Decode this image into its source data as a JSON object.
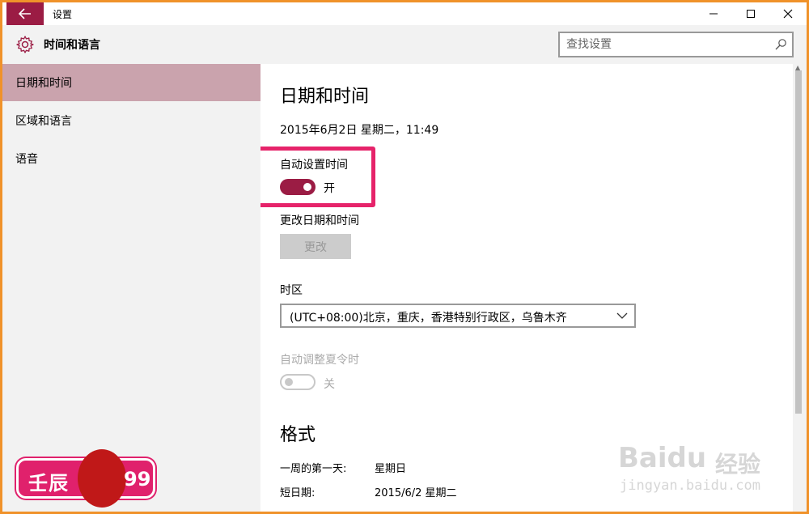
{
  "window": {
    "title": "设置",
    "back_icon": "arrow-left-icon",
    "controls": [
      "minimize-icon",
      "maximize-icon",
      "close-icon"
    ]
  },
  "header": {
    "title": "时间和语言",
    "icon": "gear-icon",
    "search_placeholder": "查找设置"
  },
  "sidebar": {
    "items": [
      {
        "label": "日期和时间",
        "active": true
      },
      {
        "label": "区域和语言",
        "active": false
      },
      {
        "label": "语音",
        "active": false
      }
    ]
  },
  "main": {
    "title": "日期和时间",
    "current_datetime": "2015年6月2日 星期二，11:49",
    "auto_time": {
      "label": "自动设置时间",
      "state": "开",
      "on": true
    },
    "change_datetime": {
      "label": "更改日期和时间",
      "button": "更改"
    },
    "timezone": {
      "label": "时区",
      "value": "(UTC+08:00)北京，重庆，香港特别行政区，乌鲁木齐"
    },
    "dst": {
      "label": "自动调整夏令时",
      "state": "关",
      "on": false
    },
    "format": {
      "title": "格式",
      "rows": [
        {
          "label": "一周的第一天:",
          "value": "星期日"
        },
        {
          "label": "短日期:",
          "value": "2015/6/2 星期二"
        }
      ]
    }
  },
  "overlay": {
    "badge_text": "壬辰",
    "badge_number": "99",
    "watermark_brand": "Baidu",
    "watermark_cn": "经验",
    "watermark_url": "jingyan.baidu.com"
  },
  "colors": {
    "accent": "#9b1c44",
    "sidebar_active": "#caa3ad",
    "highlight": "#e6236a",
    "frame": "#f0922a"
  }
}
